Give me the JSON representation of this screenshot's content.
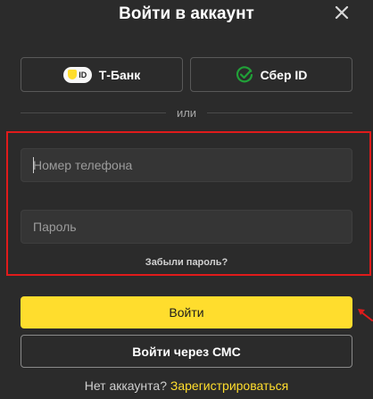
{
  "modal": {
    "title": "Войти в аккаунт"
  },
  "providers": {
    "tbank": {
      "label": "Т-Банк",
      "badge_text": "ID"
    },
    "sber": {
      "label": "Сбер ID"
    }
  },
  "divider": {
    "text": "или"
  },
  "form": {
    "phone_placeholder": "Номер телефона",
    "password_placeholder": "Пароль",
    "forgot_password": "Забыли пароль?"
  },
  "actions": {
    "login_label": "Войти",
    "sms_login_label": "Войти через СМС"
  },
  "footer": {
    "no_account": "Нет аккаунта?",
    "register": "Зарегистрироваться"
  },
  "colors": {
    "accent": "#ffdd2d",
    "highlight": "#e01b1b",
    "sber_green": "#21a038"
  },
  "icons": [
    "close-icon",
    "tbank-id-icon",
    "sber-id-icon",
    "annotation-arrow-icon"
  ]
}
